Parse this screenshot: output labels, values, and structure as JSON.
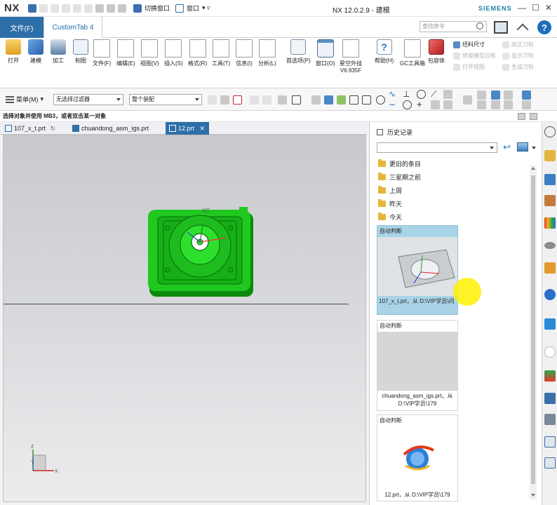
{
  "titlebar": {
    "logo": "NX",
    "title": "NX 12.0.2.9 - 建模",
    "brand": "SIEMENS",
    "switch_window": "切换窗口",
    "window_menu": "窗口",
    "quick_access_icons": [
      "save-icon",
      "undo-icon",
      "redo-icon",
      "cut-icon",
      "copy-icon",
      "paste-icon",
      "touch-mode-icon",
      "view-icon",
      "measure-icon"
    ]
  },
  "tabs": {
    "file": "文件(F)",
    "custom": "CustomTab 4",
    "search_placeholder": "查找命令"
  },
  "ribbon": {
    "buttons": [
      "打开",
      "建模",
      "加工",
      "制图",
      "文件(F)",
      "编辑(E)",
      "视图(V)",
      "插入(S)",
      "格式(R)",
      "工具(T)",
      "信息(I)",
      "分析(L)",
      "首选项(P)",
      "窗口(O)",
      "星空外挂",
      "帮助(H)",
      "GC工具箱",
      "包容体"
    ],
    "version": "V6.935F",
    "right_tools": [
      {
        "label": "坯料尺寸",
        "enabled": true
      },
      {
        "label": "转换模型边框",
        "enabled": false
      },
      {
        "label": "打开视图",
        "enabled": false
      },
      {
        "label": "改正刀轨",
        "enabled": false
      },
      {
        "label": "显示刀轨",
        "enabled": false
      },
      {
        "label": "生成刀轨",
        "enabled": false
      }
    ]
  },
  "toolbar": {
    "menu": "菜单(M)",
    "filter": "无选择过滤器",
    "assembly": "整个装配"
  },
  "cue": {
    "text": "选择对象并使用 MB3，或者双击某一对象"
  },
  "doc_tabs": [
    {
      "label": "107_x_t.prt",
      "active": false
    },
    {
      "label": "chuandong_asm_igs.prt",
      "active": false
    },
    {
      "label": "12.prt",
      "active": true
    }
  ],
  "viewport": {
    "axis_label": "XC",
    "triad_z": "Z",
    "triad_y": "Y",
    "triad_x": "X",
    "colors": {
      "part_green": "#1ec81e",
      "part_dark": "#0c8a0c"
    }
  },
  "history": {
    "title": "历史记录",
    "folders": [
      "更旧的条目",
      "三星期之前",
      "上周",
      "昨天",
      "今天"
    ],
    "cards": [
      {
        "header": "自动判断",
        "caption": "107_x_t.prt，从 D:\\VIP学员\\问",
        "selected": true
      },
      {
        "header": "自动判断",
        "caption": "chuandong_asm_igs.prt，从 D:\\VIP学员\\179",
        "selected": false
      },
      {
        "header": "自动判断",
        "caption": "12.prt，从 D:\\VIP学员\\179",
        "selected": false
      }
    ]
  },
  "resource_bar": {
    "icons": [
      "settings-icon",
      "assembly-navigator-icon",
      "constraint-navigator-icon",
      "part-navigator-icon",
      "reuse-library-icon",
      "hd3d-icon",
      "web-browser-icon",
      "roles-icon",
      "system-materials-icon",
      "history-icon",
      "process-studio-icon",
      "manufacturing-wizard-icon",
      "roles-icon-2",
      "palette-icon",
      "palette-icon-2"
    ]
  },
  "colors": {
    "accent": "#2d6fa8",
    "selection": "#a9d3e6"
  }
}
